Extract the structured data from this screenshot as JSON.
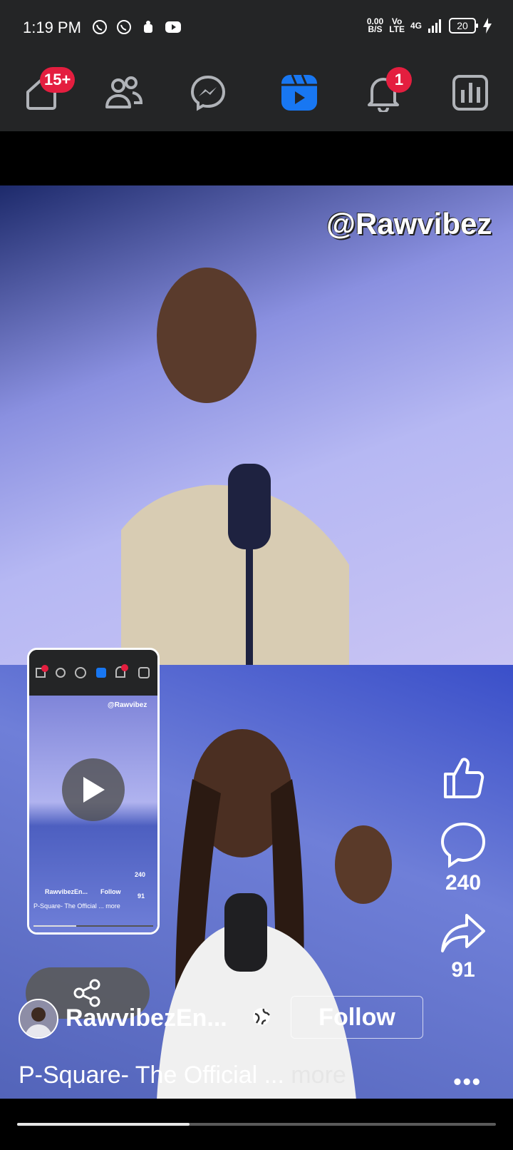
{
  "status": {
    "time": "1:19 PM",
    "speed_value": "0.00",
    "speed_unit": "B/S",
    "net_top": "Vo",
    "net_bottom": "LTE",
    "gen": "4G",
    "battery": "20"
  },
  "nav": {
    "home_badge": "15+",
    "notifications_badge": "1",
    "active_tab": "video"
  },
  "video": {
    "watermark": "@Rawvibez",
    "like_count": "",
    "comment_count": "240",
    "share_count": "91",
    "author": "RawvibezEn...",
    "follow_label": "Follow",
    "caption": "P-Square- The Official ...",
    "more_label": "more",
    "progress": 0.36
  },
  "pip": {
    "watermark": "@Rawvibez",
    "comment_count": "240",
    "share_count": "91",
    "author": "RawvibezEn...",
    "follow_label": "Follow",
    "caption": "P-Square- The Official ... more"
  },
  "colors": {
    "bar_bg": "#242526",
    "accent": "#1877f2",
    "badge": "#e41e3f"
  }
}
